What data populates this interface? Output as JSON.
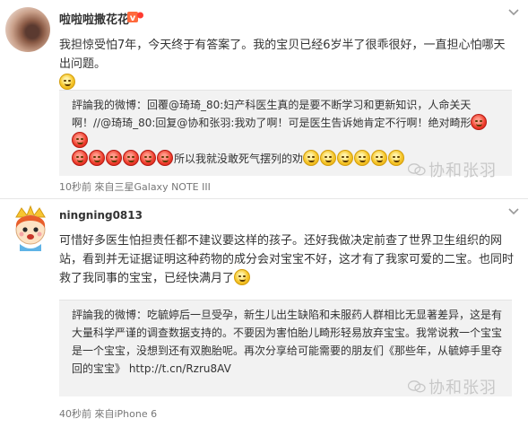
{
  "posts": [
    {
      "username": "啦啦啦撒花花",
      "content": "我担惊受怕7年，今天终于有答案了。我的宝贝已经6岁半了很乖很好，一直担心怕哪天出问题。",
      "content_emoji": [
        "yellow-smile-emoji"
      ],
      "quote": {
        "text": "評論我的微博：回覆@琦琦_80:妇产科医生真的是要不断学习和更新知识，人命关天啊！//@琦琦_80:回复@协和张羽:我劝了啊！可是医生告诉她肯定不行啊！绝对畸形",
        "emoji_after_text": [
          "red-angry-emoji",
          "red-angry-emoji"
        ],
        "line3_emoji": [
          "red-angry-emoji",
          "red-angry-emoji",
          "red-angry-emoji",
          "red-angry-emoji",
          "red-angry-emoji",
          "red-angry-emoji"
        ],
        "tail": "所以我就没敢死气摆列的劝",
        "tail_emoji": [
          "yellow-cry-emoji",
          "yellow-cry-emoji",
          "yellow-cry-emoji",
          "yellow-cry-emoji",
          "yellow-cry-emoji",
          "yellow-cry-emoji"
        ]
      },
      "meta": "10秒前 來自三星Galaxy NOTE III",
      "watermark": "协和张羽"
    },
    {
      "username": "ningning0813",
      "content": "可惜好多医生怕担责任都不建议要这样的孩子。还好我做决定前查了世界卫生组织的网站，看到并无证据证明这种药物的成分会对宝宝不好，这才有了我家可爱的二宝。也同时救了我同事的宝宝，已经快满月了",
      "content_emoji": [
        "yellow-smile-emoji"
      ],
      "quote": {
        "text": "評論我的微博：吃毓婷后一旦受孕，新生儿出生缺陷和未服药人群相比无显著差异，这是有大量科学严谨的调查数据支持的。不要因为害怕胎儿畸形轻易放弃宝宝。我常说救一个宝宝是一个宝宝，没想到还有双胞胎呢。再次分享给可能需要的朋友们《那些年，从毓婷手里夺回的宝宝》 http://t.cn/Rzru8AV"
      },
      "meta": "40秒前 來自iPhone 6",
      "watermark": "协和张羽"
    }
  ],
  "colors": {
    "background": "#ffffff",
    "quote_bg": "#f2f2f2",
    "meta_text": "#777777",
    "watermark": "#c8c8c8"
  }
}
